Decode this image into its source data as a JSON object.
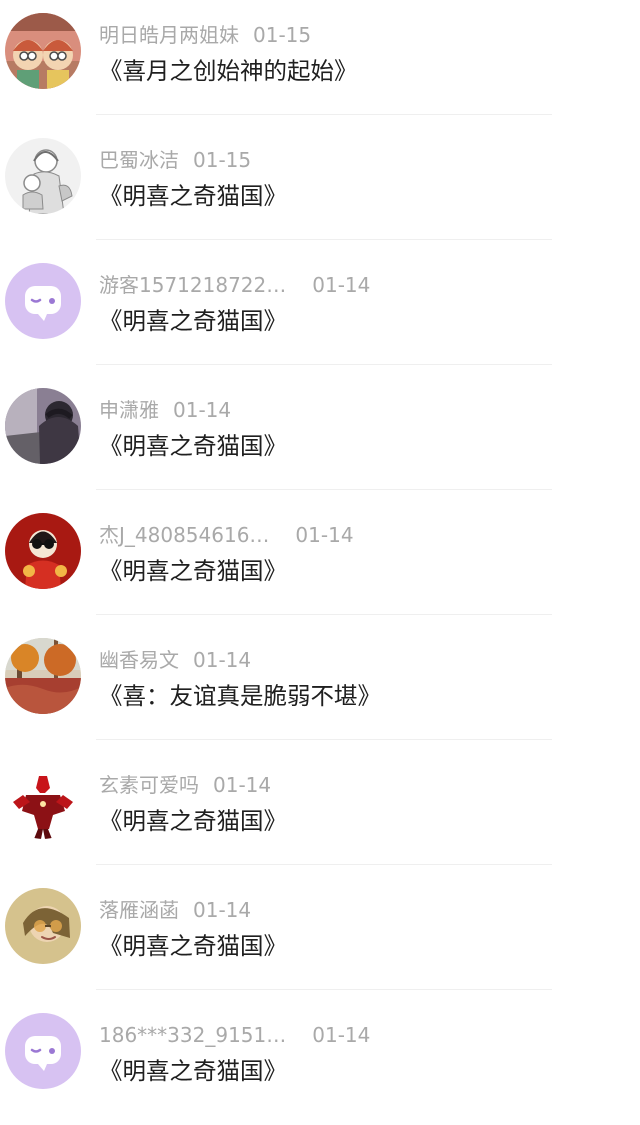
{
  "feed": {
    "items": [
      {
        "user": "明日皓月两姐妹",
        "time": "01-15",
        "title": "《喜月之创始神的起始》",
        "avatar": "avatar-cartoon-sisters"
      },
      {
        "user": "巴蜀冰洁",
        "time": "01-15",
        "title": "《明喜之奇猫国》",
        "avatar": "avatar-sketch-mother-child"
      },
      {
        "user": "游客1571218722…",
        "time": "01-14",
        "title": "《明喜之奇猫国》",
        "avatar": "avatar-default-chat"
      },
      {
        "user": "申潇雅",
        "time": "01-14",
        "title": "《明喜之奇猫国》",
        "avatar": "avatar-dark-portrait"
      },
      {
        "user": "杰J_480854616…",
        "time": "01-14",
        "title": "《明喜之奇猫国》",
        "avatar": "avatar-red-cartoon"
      },
      {
        "user": "幽香易文",
        "time": "01-14",
        "title": "《喜：友谊真是脆弱不堪》",
        "avatar": "avatar-autumn-forest"
      },
      {
        "user": "玄素可爱吗",
        "time": "01-14",
        "title": "《明喜之奇猫国》",
        "avatar": "avatar-red-robot"
      },
      {
        "user": "落雁涵菡",
        "time": "01-14",
        "title": "《明喜之奇猫国》",
        "avatar": "avatar-girl-sunglasses"
      },
      {
        "user": "186***332_9151…",
        "time": "01-14",
        "title": "《明喜之奇猫国》",
        "avatar": "avatar-default-chat"
      }
    ]
  },
  "colors": {
    "username": "#a9a9a9",
    "title": "#1f1f1f",
    "divider": "#efefef",
    "default_avatar": "#d7c2f2"
  }
}
